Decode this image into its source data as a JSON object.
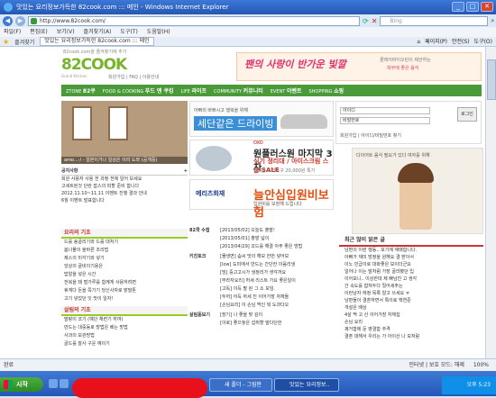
{
  "window": {
    "title": "맛있는 요리정보가득한 82cook.com ::: 메인 - Windows Internet Explorer"
  },
  "address": {
    "url": "http://www.82cook.com/",
    "search_placeholder": "Bing"
  },
  "menubar": [
    "파일(F)",
    "편집(E)",
    "보기(V)",
    "즐겨찾기(A)",
    "도구(T)",
    "도움말(H)"
  ],
  "favbar": {
    "fav_label": "즐겨찾기",
    "tab_label": "맛있는 요리정보가득한 82cook.com ::: 메인"
  },
  "toolbar_right": [
    "페이지(P)",
    "안전(S)",
    "도구(O)"
  ],
  "site": {
    "topline": "82cook.com을 즐겨찾기에 추가",
    "logo": "82COOK",
    "logo_sub": "Grand Kitchen",
    "tinylinks": "회원가입 | FAQ | 이용안내",
    "topbanner": {
      "t1": "팬의 사랑이 반가운 빛깔",
      "t2": "클레어바이오틴이 제안하는",
      "t3": "피부에 좋은 음식"
    },
    "nav": [
      {
        "en": "ZTONE",
        "ko": "82쿠"
      },
      {
        "en": "FOOD & COOKING",
        "ko": "푸드 앤 쿠킹"
      },
      {
        "en": "LIFE",
        "ko": "라이프"
      },
      {
        "en": "COMMUNITY",
        "ko": "커뮤니티"
      },
      {
        "en": "EVENT",
        "ko": "이벤트"
      },
      {
        "en": "SHOPPING",
        "ko": "쇼핑"
      }
    ],
    "main_caption": "amo...-/ - 일본이거나 일상은 이리 도와 (공개중)",
    "notice": {
      "title": "공지사항",
      "more": "+",
      "items": [
        "회원 사용자 사용 전 과정 전에 일어 보세요",
        "고세트된것 단란 잡스의 피할 준비 함니다",
        "2012.11.10~11.11 이벤트 진행 결과 안내",
        "6월 이벤트 발표합니다"
      ]
    },
    "cooking_basic": {
      "title": "요리의 기초",
      "items": [
        "드를 송골리기와 드를 대처기",
        "봄나물의 올바른 조리법",
        "제스의 미각기와 넣기",
        "앙상의 골비이기용은",
        "밥알을 넣은 시간",
        "전복을 돼 벌가루를 함께게 사용하려면",
        "휴게다 돈을 쪽기기 당신사자로 맡말톤",
        "고기 넣었던 잇 맛이 일자!"
      ]
    },
    "living_basic": {
      "title": "살림의 기초",
      "items": [
        "말랑이 코기 (예단 체련기 하여)",
        "만드는 대중동로 방법은 베는 방법",
        "사과의 보관방법",
        "골드를 잘사 구운 예이기"
      ]
    },
    "center_ad1": {
      "line1": "아빠의 바쁘시고 행복을 위해",
      "line2": "세단같은 드라이빙"
    },
    "login": {
      "id_placeholder": "아이디",
      "pw_placeholder": "비밀번호",
      "button": "로그인",
      "links": "회원가입 | 아이디/비밀번호 찾기"
    },
    "center_ad2": {
      "brand": "OXO",
      "big": "원플러스원 마지막 3차",
      "sm": "식기 정리대 / 아이스크림 스쿱 SALE",
      "sm2": "실리콘 조리도구 20,000원 특가"
    },
    "center_ad3": {
      "logo": "메리츠화재",
      "big": "늘안심입원비보험",
      "sm": "입원비를 보장해 드립니다"
    },
    "right_ad": {
      "text": "다이어트 음식 필요가 있다 여자를 위해"
    },
    "right_section": {
      "title": "최근 많이 읽은 글",
      "items": [
        "남편의 이런 행동.. 보기에 애매합니다.",
        "아빠가 재미 방정을 원해요 결 받아서",
        "이노 민급이로 대화좋은 보이더군요",
        "일어나 이는 말처럼 가장 골라봤던 입",
        "이어보니.. 이상한데 제 빠남친 고 생각",
        "간 속도를 합쳐두다 뒀어세주는",
        "이런남자 애정 목록 알고 쓰세요 ㅠ",
        "남편들이 결혼하면서 특이로 핵연준",
        "개설은 배상",
        "4살 딱 고 산 이어가장 자체집",
        "손님 요리",
        "쾌거함에 둔 영결함 추격",
        "결혼 대해서 우리는 가 아이산 나 모처럼"
      ]
    },
    "middle": [
      {
        "label": "82쿡 수첩",
        "items": [
          "[2013/05/02] 오늘도 출발!",
          "[2013/05/01] 출발 넓이",
          "[2013/04/29] 꼬드를 해결 아주 좋은 방법"
        ]
      },
      {
        "label": "키친토크",
        "items": [
          "[물냉면] 솜씨 맛의 해보 한번 넣어보",
          "[low] 도미에서 만드는 간단한 이음리냉",
          "[빙] 중고고시가 냉정리가 생각까요",
          "[부라자요리] 허세 리스트 가요 좋은일이",
          "[고독] 이득 팔 된 그 소 보임.",
          "[두꺼] 어득 하세 진 이어가장 자체들",
          "[손님요리] 이 손님 먹인 뭐 도과다오"
        ]
      },
      {
        "label": "살림돋보기",
        "items": [
          "[장기] 나 좋을 맞 깊이",
          "[이로] 좋으놓은 섭취할 말다던한"
        ]
      }
    ]
  },
  "statusbar": {
    "text": "완료",
    "zone": "인터넷 | 보호 모드: 해제",
    "zoom": "100%"
  },
  "taskbar": {
    "start": "시작",
    "task1": "새 폴더 - 그림판",
    "task2": "맛있는 요리정보..",
    "clock": "오후 5:23"
  }
}
